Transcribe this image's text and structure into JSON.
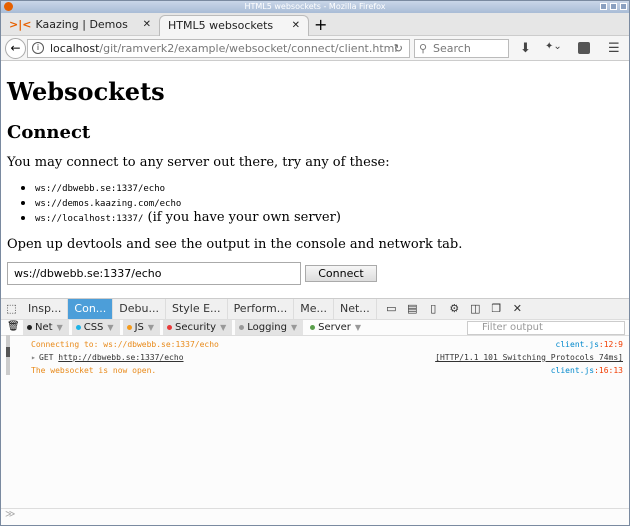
{
  "window": {
    "title": "HTML5 websockets - Mozilla Firefox"
  },
  "tabs": [
    {
      "label": "Kaazing | Demos"
    },
    {
      "label": "HTML5 websockets"
    }
  ],
  "nav": {
    "url_host": "localhost",
    "url_path": "/git/ramverk2/example/websocket/connect/client.html",
    "search_placeholder": "Search"
  },
  "page": {
    "h1": "Websockets",
    "h2": "Connect",
    "intro": "You may connect to any server out there, try any of these:",
    "servers": [
      {
        "url": "ws://dbwebb.se:1337/echo",
        "note": ""
      },
      {
        "url": "ws://demos.kaazing.com/echo",
        "note": ""
      },
      {
        "url": "ws://localhost:1337/",
        "note": " (if you have your own server)"
      }
    ],
    "hint": "Open up devtools and see the output in the console and network tab.",
    "input_value": "ws://dbwebb.se:1337/echo",
    "connect_label": "Connect"
  },
  "devtools": {
    "accent": "#4c9ed9",
    "tabs": [
      "Insp...",
      "Con...",
      "Debu...",
      "Style E...",
      "Perform...",
      "Me...",
      "Net..."
    ],
    "filters": [
      {
        "label": "Net",
        "color": "#222222"
      },
      {
        "label": "CSS",
        "color": "#1fb3e6"
      },
      {
        "label": "JS",
        "color": "#f39a1c"
      },
      {
        "label": "Security",
        "color": "#e83a3a"
      },
      {
        "label": "Logging",
        "color": "#999999"
      },
      {
        "label": "Server",
        "color": "#5a9e4b"
      }
    ],
    "filter_placeholder": "Filter output",
    "log": [
      {
        "text": "Connecting to: ws://dbwebb.se:1337/echo",
        "file": "client.js",
        "pos": ":12:9",
        "color": "#e88a1a"
      },
      {
        "method": "GET",
        "url": "http://dbwebb.se:1337/echo",
        "status": "[HTTP/1.1 101 Switching Protocols 74ms]"
      },
      {
        "text": "The websocket is now open.",
        "file": "client.js",
        "pos": ":16:13",
        "color": "#e88a1a"
      }
    ],
    "prompt": "≫"
  }
}
